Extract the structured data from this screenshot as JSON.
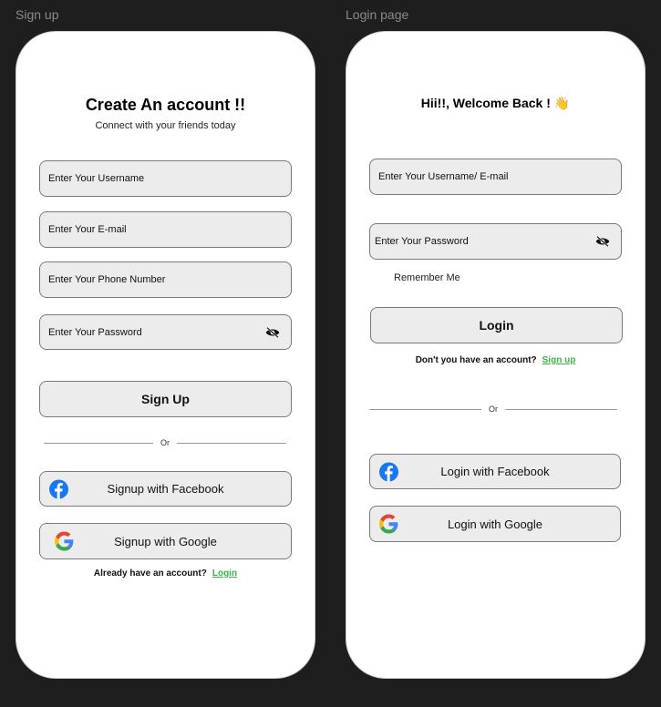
{
  "signup": {
    "frame_label": "Sign up",
    "title": "Create An account !!",
    "subtitle": "Connect with your friends today",
    "username_placeholder": "Enter Your Username",
    "email_placeholder": "Enter Your E-mail",
    "phone_placeholder": "Enter Your Phone Number",
    "password_placeholder": "Enter Your Password",
    "submit_label": "Sign Up",
    "divider_text": "Or",
    "facebook_label": "Signup with Facebook",
    "google_label": "Signup with Google",
    "footer_text": "Already have an account?",
    "footer_link": "Login"
  },
  "login": {
    "frame_label": "Login page",
    "title": "Hii!!, Welcome Back ! 👋",
    "username_placeholder": "Enter Your Username/ E-mail",
    "password_placeholder": "Enter Your Password",
    "remember_label": "Remember Me",
    "submit_label": "Login",
    "footer_text": "Don't you have an account?",
    "footer_link": "Sign up",
    "divider_text": "Or",
    "facebook_label": "Login with Facebook",
    "google_label": "Login with Google"
  },
  "colors": {
    "background": "#1e1e1e",
    "link": "#3bb54a",
    "facebook": "#1877f2"
  },
  "icons": [
    "eye-slash-icon",
    "facebook-icon",
    "google-icon"
  ]
}
